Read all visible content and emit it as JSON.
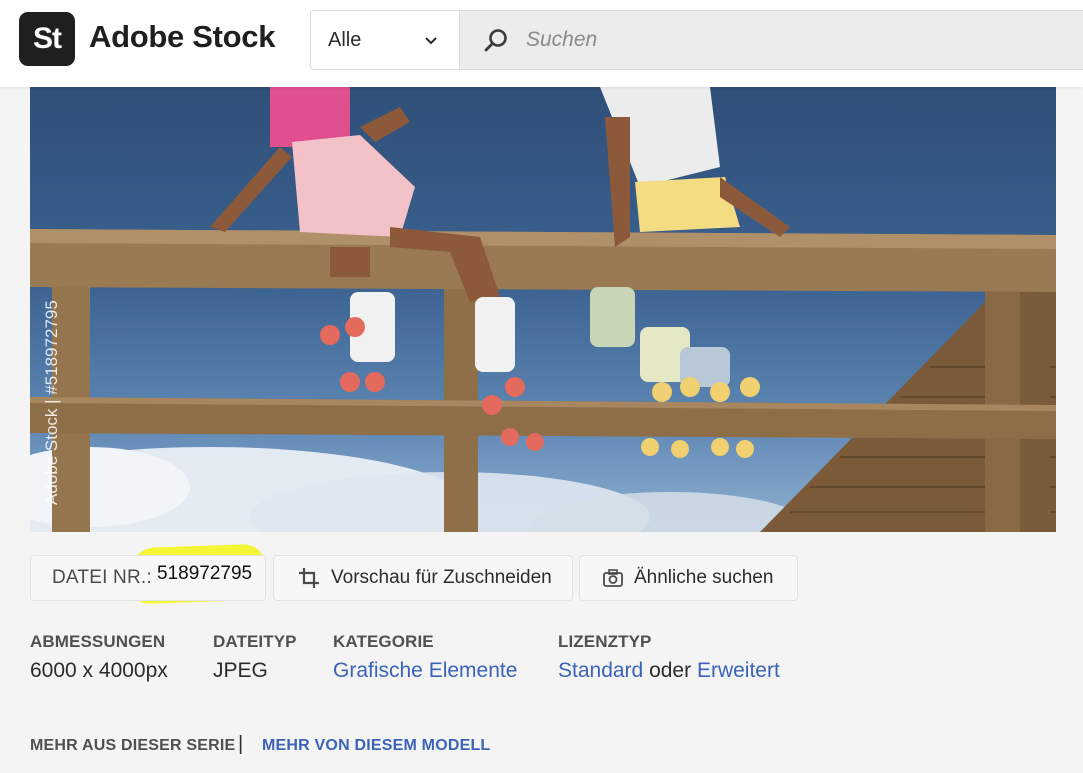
{
  "header": {
    "logo_badge": "St",
    "logo_text": "Adobe Stock",
    "search": {
      "category": "Alle",
      "placeholder": "Suchen",
      "search_icon": "search-icon",
      "dropdown_icon": "chevron-down-icon"
    }
  },
  "image": {
    "side_watermark": "Adobe Stock | #518972795",
    "overlay_watermark": "Adobe Stock",
    "description_colors": {
      "sky": "#3c6391",
      "wood": "#8a6a44"
    }
  },
  "actions": {
    "file_label": "DATEI NR.:",
    "file_number": "518972795",
    "crop_label": "Vorschau für Zuschneiden",
    "similar_label": "Ähnliche suchen"
  },
  "meta": {
    "dimensions_label": "ABMESSUNGEN",
    "dimensions_value": "6000 x 4000px",
    "filetype_label": "DATEITYP",
    "filetype_value": "JPEG",
    "category_label": "KATEGORIE",
    "category_value": "Grafische Elemente",
    "license_label": "LIZENZTYP",
    "license_standard": "Standard",
    "license_or": "oder",
    "license_extended": "Erweitert"
  },
  "more": {
    "series": "MEHR AUS DIESER SERIE",
    "separator": "|",
    "model": "MEHR VON DIESEM MODELL"
  },
  "colors": {
    "accent_link": "#3b63b7",
    "highlight": "#f3f62a"
  }
}
